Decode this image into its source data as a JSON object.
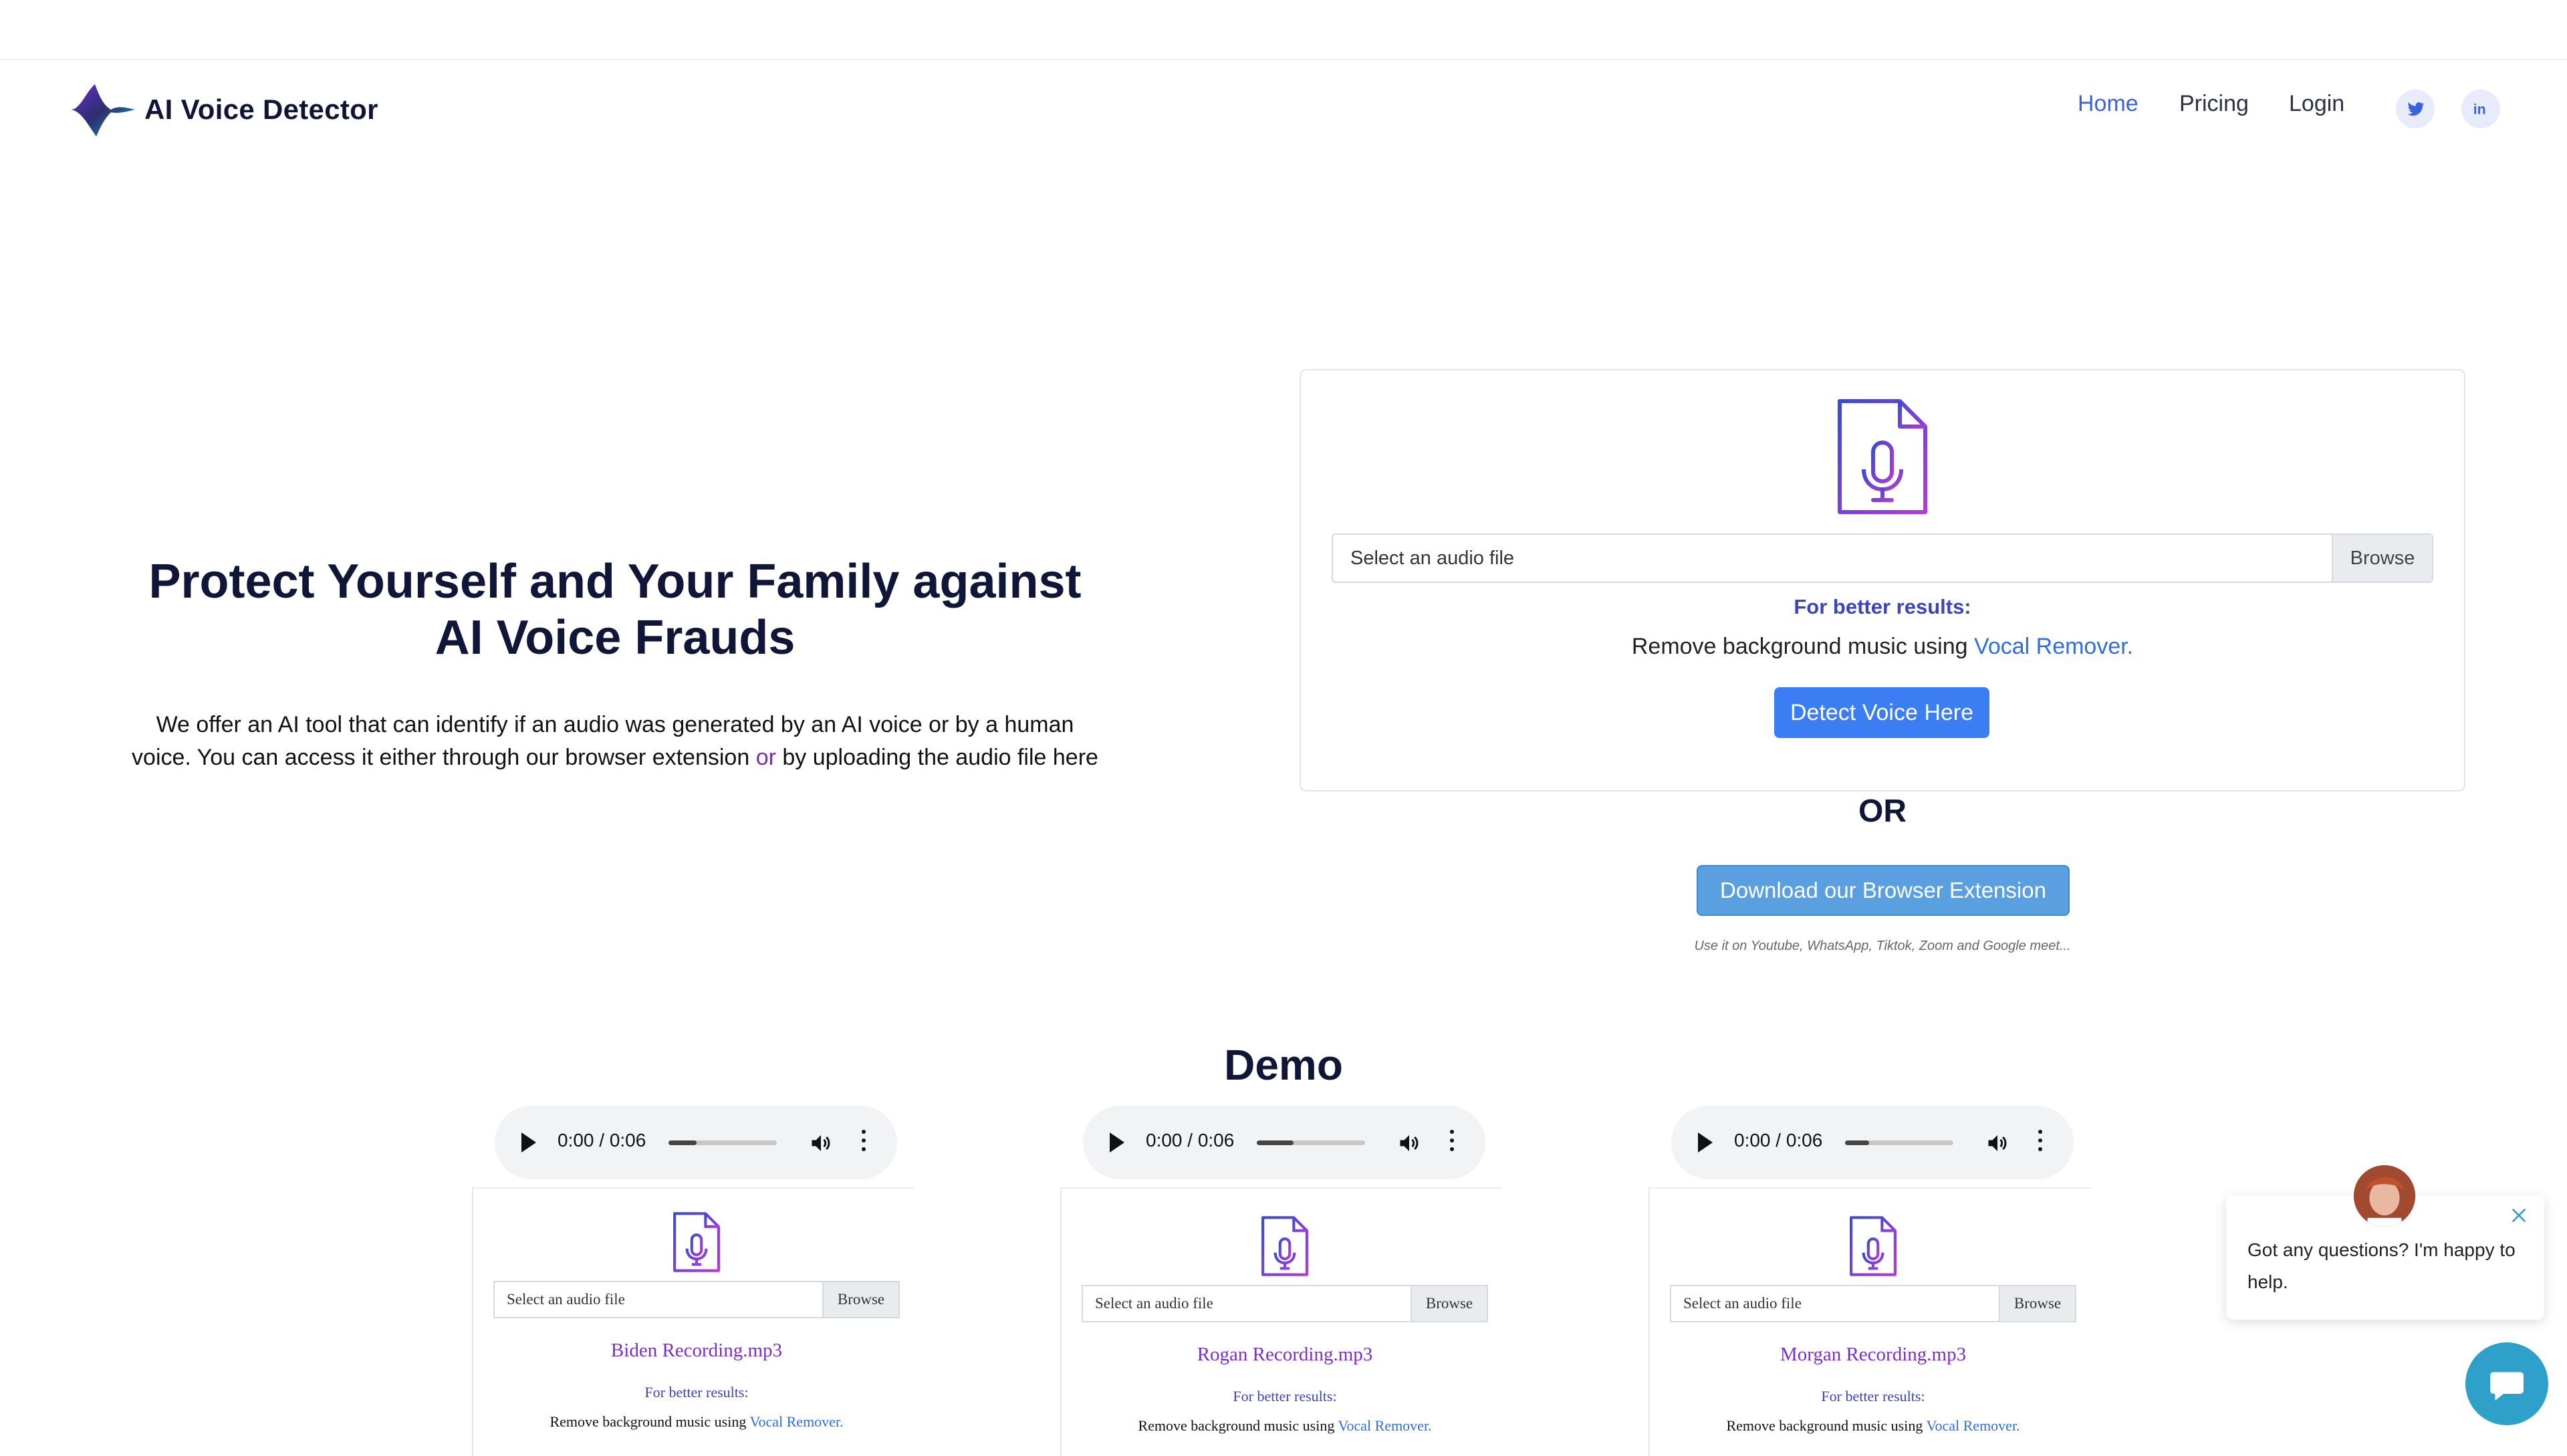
{
  "header": {
    "logo_text": "AI Voice Detector",
    "nav": [
      "Home",
      "Pricing",
      "Login"
    ],
    "active_nav": "Home",
    "social": [
      "twitter-icon",
      "linkedin-icon"
    ]
  },
  "hero": {
    "title": "Protect Yourself and Your Family against AI Voice Frauds",
    "desc_part1": "We offer an AI tool that can identify if an audio was generated by an AI voice or by a human voice. You can access it either through our browser extension ",
    "desc_or": "or",
    "desc_part2": " by uploading the audio file here"
  },
  "upload": {
    "placeholder": "Select an audio file",
    "browse": "Browse",
    "better_results": "For better results:",
    "remove_text": "Remove background music using ",
    "vocal_remover": "Vocal Remover.",
    "detect_button": "Detect Voice Here"
  },
  "or_label": "OR",
  "extension": {
    "button": "Download our Browser Extension",
    "note": "Use it on Youtube, WhatsApp, Tiktok, Zoom and Google meet..."
  },
  "demo": {
    "title": "Demo",
    "items": [
      {
        "time": "0:00 / 0:06",
        "progress": 0.26,
        "placeholder": "Select an audio file",
        "browse": "Browse",
        "file": "Biden Recording.mp3",
        "better": "For better results:",
        "remove_text": "Remove background music using ",
        "vocal_remover": "Vocal Remover."
      },
      {
        "time": "0:00 / 0:06",
        "progress": 0.34,
        "placeholder": "Select an audio file",
        "browse": "Browse",
        "file": "Rogan Recording.mp3",
        "better": "For better results:",
        "remove_text": "Remove background music using ",
        "vocal_remover": "Vocal Remover."
      },
      {
        "time": "0:00 / 0:06",
        "progress": 0.22,
        "placeholder": "Select an audio file",
        "browse": "Browse",
        "file": "Morgan Recording.mp3",
        "better": "For better results:",
        "remove_text": "Remove background music using ",
        "vocal_remover": "Vocal Remover."
      }
    ]
  },
  "chat": {
    "message": "Got any questions? I'm happy to help."
  },
  "colors": {
    "accent": "#3b7df2",
    "nav_active": "#3b63d9",
    "file_name": "#7b2fc8",
    "chat_launcher": "#2fa0c9"
  }
}
